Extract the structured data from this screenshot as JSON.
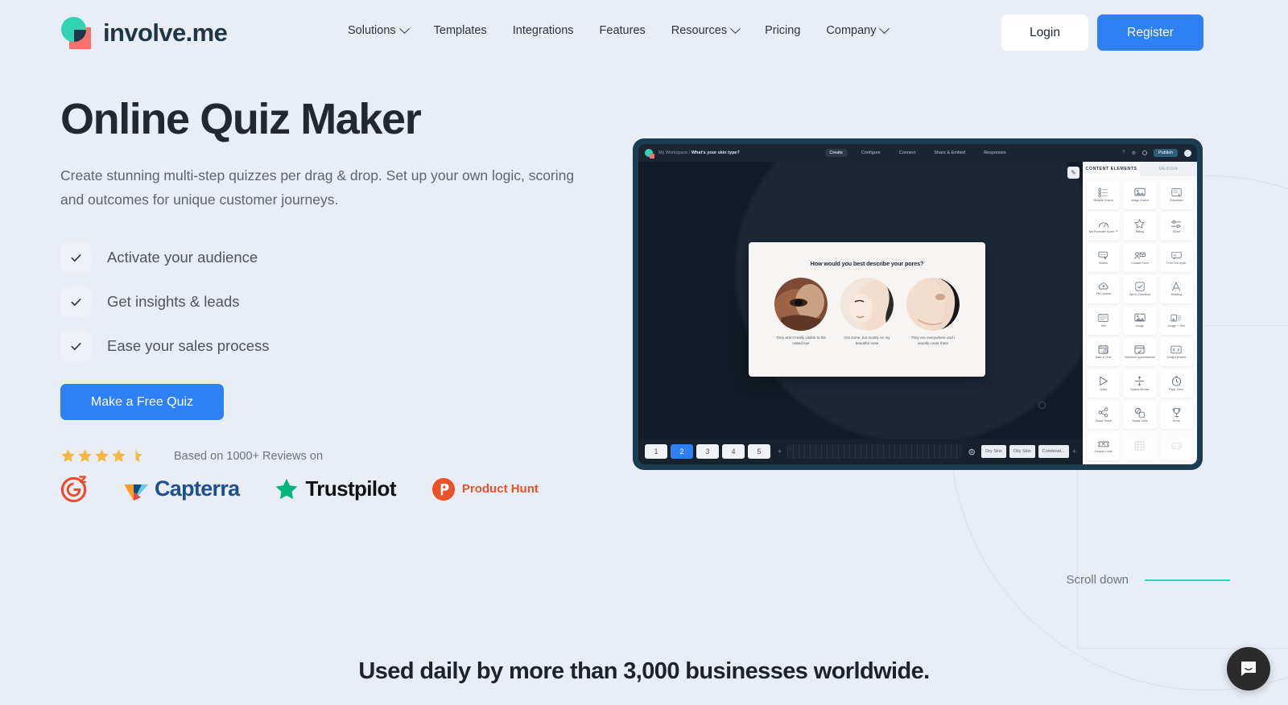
{
  "brand": {
    "name": "involve.me",
    "colors": {
      "teal": "#2fd4b5",
      "coral": "#f4726a",
      "navy": "#1f3648",
      "blue": "#2f7ff6"
    }
  },
  "nav": {
    "items": [
      {
        "label": "Solutions",
        "caret": true
      },
      {
        "label": "Templates",
        "caret": false
      },
      {
        "label": "Integrations",
        "caret": false
      },
      {
        "label": "Features",
        "caret": false
      },
      {
        "label": "Resources",
        "caret": true
      },
      {
        "label": "Pricing",
        "caret": false
      },
      {
        "label": "Company",
        "caret": true
      }
    ],
    "login": "Login",
    "register": "Register"
  },
  "hero": {
    "title": "Online Quiz Maker",
    "subtitle": "Create stunning multi-step quizzes per drag & drop. Set up your own logic, scoring and outcomes for unique customer journeys.",
    "checks": [
      "Activate your audience",
      "Get insights & leads",
      "Ease your sales process"
    ],
    "cta": "Make a Free Quiz",
    "rating": {
      "value": 4.5,
      "max": 5,
      "text": "Based on 1000+ Reviews on"
    },
    "review_logos": [
      {
        "name": "G2",
        "label": "G2"
      },
      {
        "name": "Capterra",
        "label": "Capterra"
      },
      {
        "name": "Trustpilot",
        "label": "Trustpilot"
      },
      {
        "name": "Product Hunt",
        "label": "Product Hunt"
      }
    ]
  },
  "app_mock": {
    "breadcrumb_workspace": "My Workspace /",
    "breadcrumb_project": "What's your skin type?",
    "tabs": [
      {
        "label": "Create",
        "active": true
      },
      {
        "label": "Configure",
        "active": false
      },
      {
        "label": "Connect",
        "active": false
      },
      {
        "label": "Share & Embed",
        "active": false
      },
      {
        "label": "Responses",
        "active": false
      }
    ],
    "help_icon": "question-mark-icon",
    "settings_icon": "gear-icon",
    "publish": "Publish",
    "quiz": {
      "question": "How would you best describe your pores?",
      "options": [
        "They aren't really visible to the naked eye",
        "Got some, but mostly on my beautiful nose",
        "They are everywhere and I usually cover them"
      ]
    },
    "pages": [
      "1",
      "2",
      "3",
      "4",
      "5"
    ],
    "active_page": "2",
    "add_page": "+",
    "outcomes": [
      "Dry Skin",
      "Oily Skin",
      "Combinat..."
    ],
    "add_outcome": "+",
    "panel": {
      "tabs": [
        {
          "label": "CONTENT ELEMENTS",
          "active": true
        },
        {
          "label": "DESIGN",
          "active": false
        }
      ],
      "elements": [
        {
          "label": "Multiple Choice",
          "icon": "list-icon"
        },
        {
          "label": "Image Choice",
          "icon": "image-choice-icon"
        },
        {
          "label": "Dropdown",
          "icon": "dropdown-icon"
        },
        {
          "label": "Net Promoter Score ™",
          "icon": "gauge-icon"
        },
        {
          "label": "Rating",
          "icon": "star-icon"
        },
        {
          "label": "Slider",
          "icon": "slider-icon"
        },
        {
          "label": "Button",
          "icon": "button-icon"
        },
        {
          "label": "Contact Form",
          "icon": "contact-form-icon"
        },
        {
          "label": "Free Text Input",
          "icon": "free-text-icon"
        },
        {
          "label": "File Upload",
          "icon": "upload-cloud-icon"
        },
        {
          "label": "Opt-in Checkbox",
          "icon": "checkbox-icon"
        },
        {
          "label": "Heading",
          "icon": "letter-a-icon"
        },
        {
          "label": "Text",
          "icon": "text-icon"
        },
        {
          "label": "Image",
          "icon": "image-icon"
        },
        {
          "label": "Image + Text",
          "icon": "image-text-icon"
        },
        {
          "label": "Date & Time",
          "icon": "calendar-icon"
        },
        {
          "label": "Schedule Appointments",
          "icon": "appointment-icon"
        },
        {
          "label": "Widget Embed",
          "icon": "code-icon"
        },
        {
          "label": "Video",
          "icon": "play-icon"
        },
        {
          "label": "Spacer/Divider",
          "icon": "spacer-icon"
        },
        {
          "label": "Page Timer",
          "icon": "clock-icon"
        },
        {
          "label": "Social Share",
          "icon": "share-icon"
        },
        {
          "label": "Social Links",
          "icon": "social-links-icon"
        },
        {
          "label": "Score",
          "icon": "trophy-icon"
        },
        {
          "label": "Coupon Code",
          "icon": "ticket-icon"
        },
        {
          "label": "",
          "icon": "grid-icon"
        },
        {
          "label": "",
          "icon": "card-icon"
        }
      ]
    }
  },
  "footer": {
    "scroll_down": "Scroll down",
    "used_daily": "Used daily by more than 3,000 businesses worldwide.",
    "chat_icon": "chat-bubble-icon"
  }
}
